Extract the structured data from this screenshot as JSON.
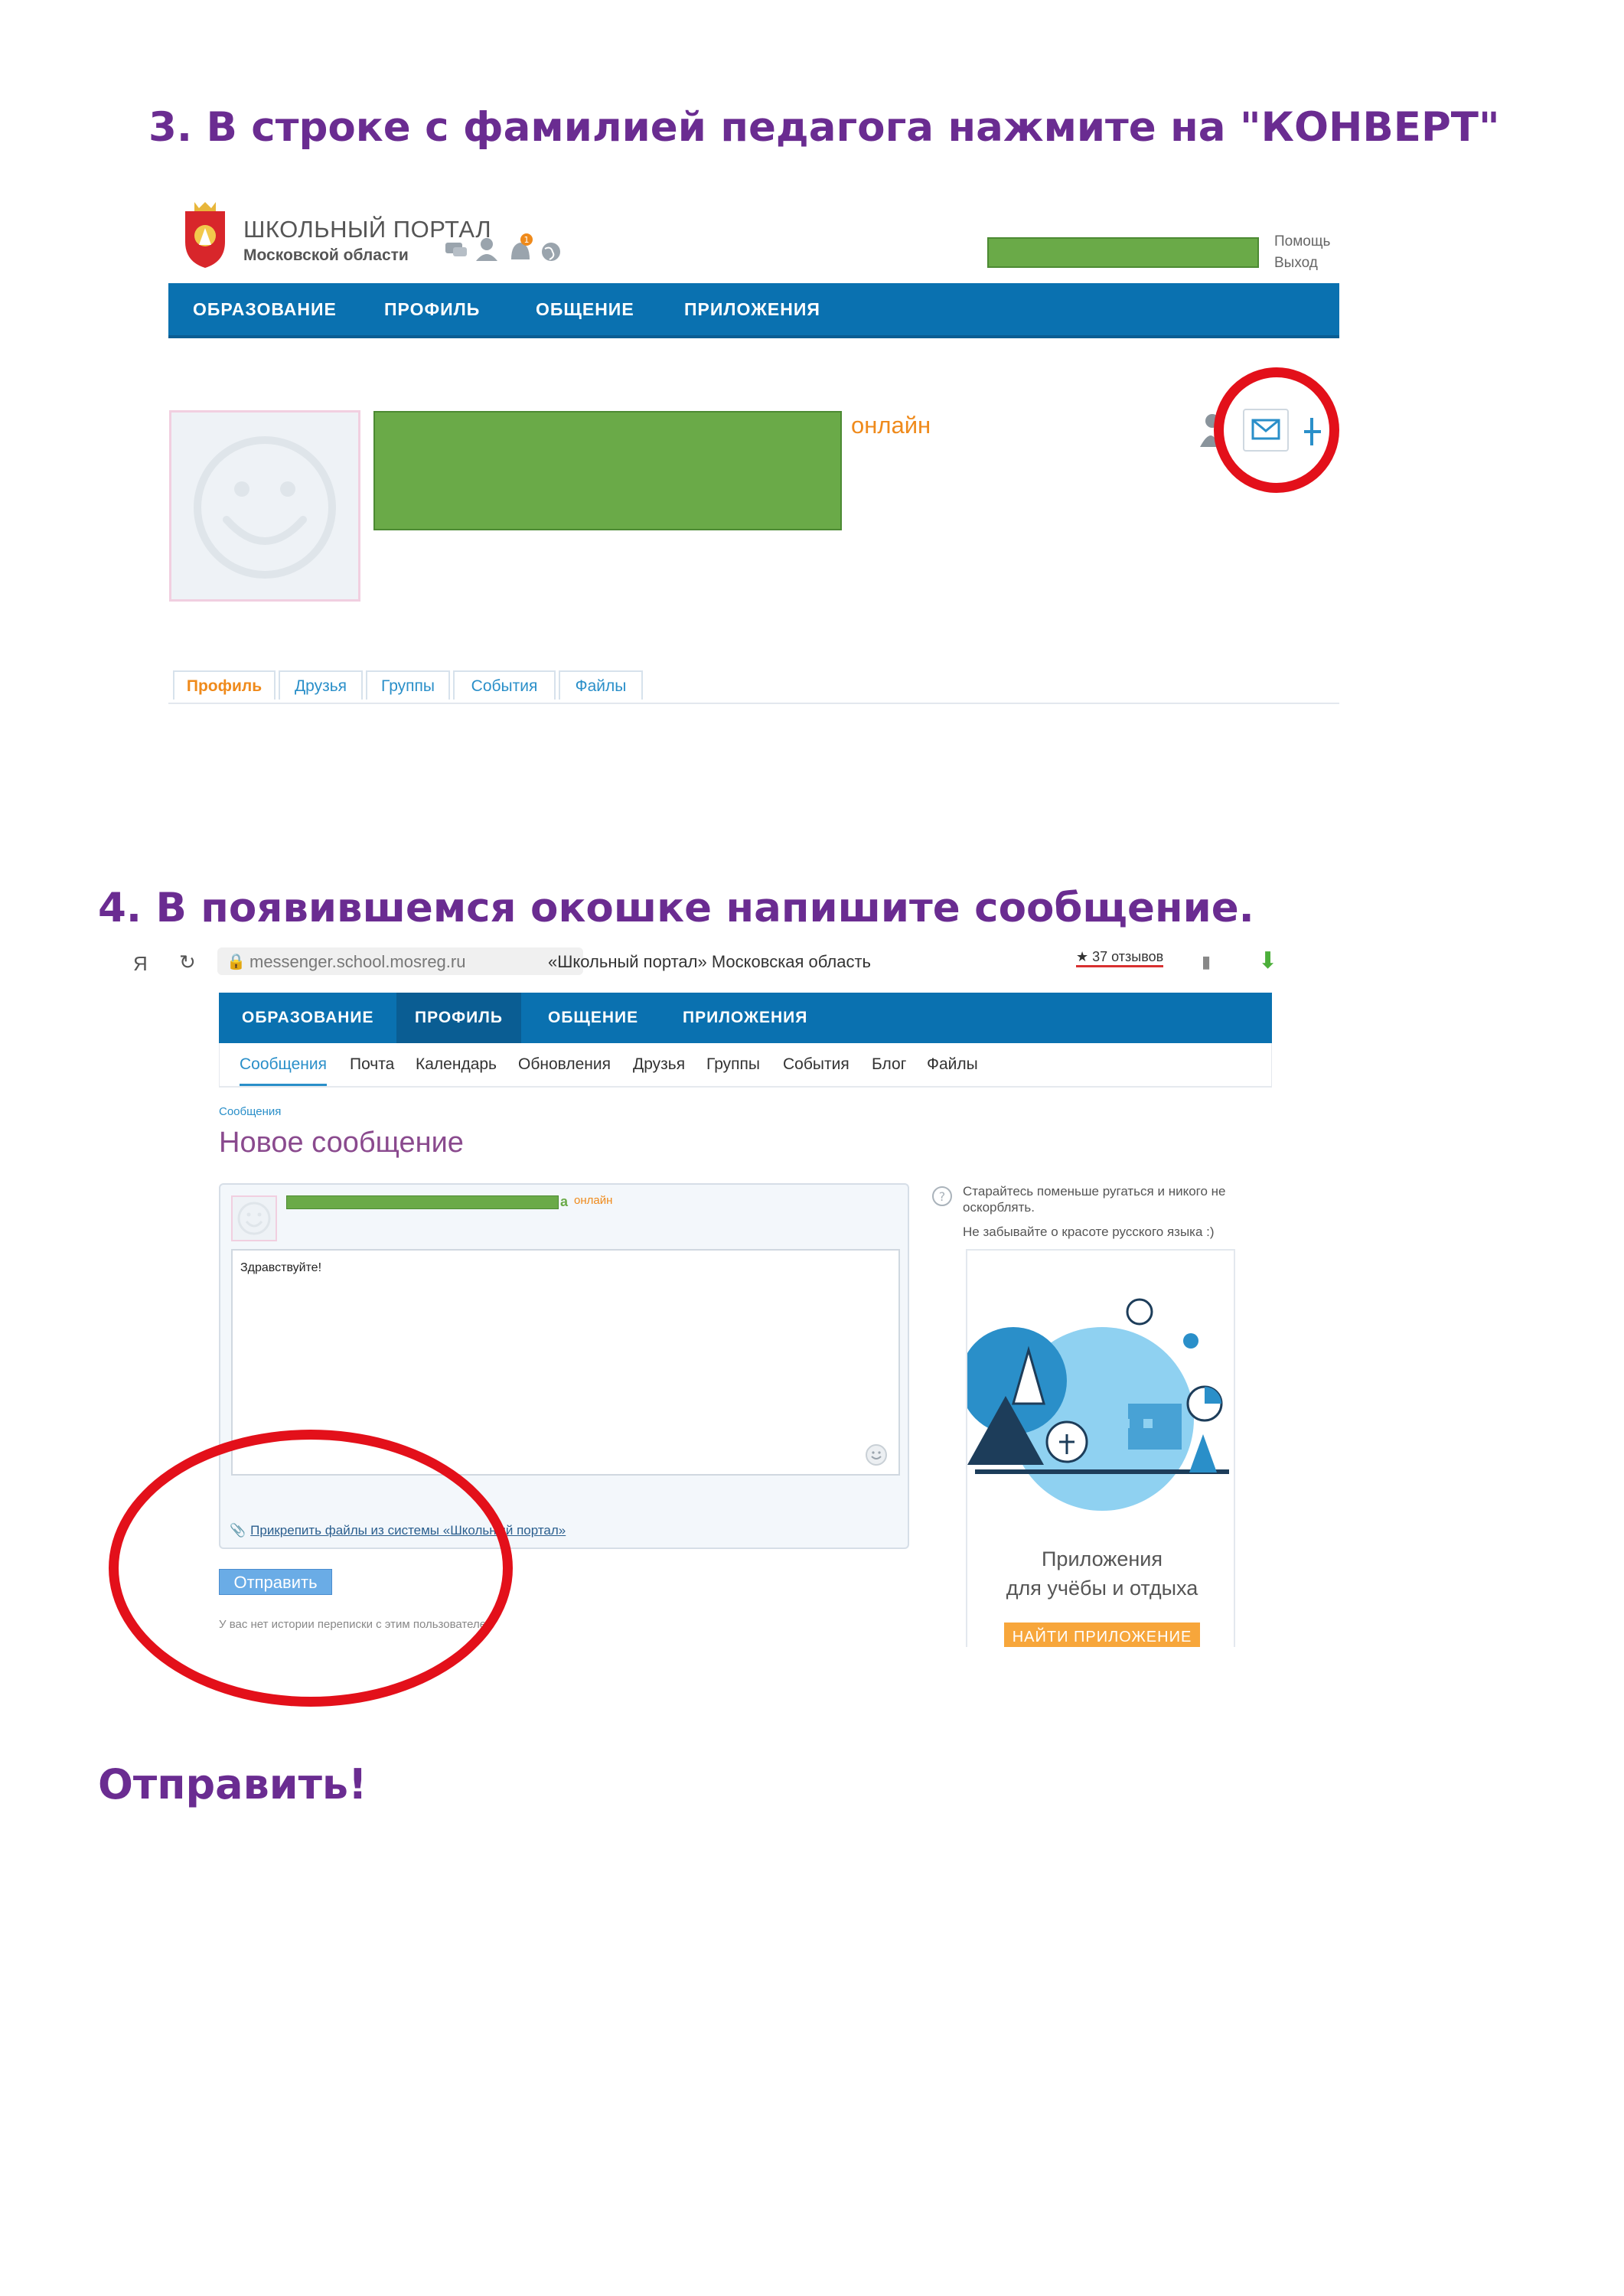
{
  "step3": {
    "heading": "3. В строке с фамилией педагога нажмите на \"КОНВЕРТ\"",
    "logo": {
      "title": "ШКОЛЬНЫЙ ПОРТАЛ",
      "subtitle": "Московской области"
    },
    "notification_count": "1",
    "top_links": {
      "help": "Помощь",
      "logout": "Выход"
    },
    "nav": [
      "ОБРАЗОВАНИЕ",
      "ПРОФИЛЬ",
      "ОБЩЕНИЕ",
      "ПРИЛОЖЕНИЯ"
    ],
    "status": "онлайн",
    "tabs": [
      "Профиль",
      "Друзья",
      "Группы",
      "События",
      "Файлы"
    ]
  },
  "step4": {
    "heading": "4. В появившемся окошке напишите сообщение.",
    "browser": {
      "yandex": "Я",
      "url": "messenger.school.mosreg.ru",
      "page_title": "«Школьный портал» Московская область",
      "reviews": "★ 37 отзывов"
    },
    "nav": [
      "ОБРАЗОВАНИЕ",
      "ПРОФИЛЬ",
      "ОБЩЕНИЕ",
      "ПРИЛОЖЕНИЯ"
    ],
    "subnav": [
      "Сообщения",
      "Почта",
      "Календарь",
      "Обновления",
      "Друзья",
      "Группы",
      "События",
      "Блог",
      "Файлы"
    ],
    "breadcrumb": "Сообщения",
    "title": "Новое сообщение",
    "recipient_tail": "а",
    "recipient_status": "онлайн",
    "message_text": "Здравствуйте!",
    "attach_link": "Прикрепить файлы из системы «Школьный портал»",
    "send_button": "Отправить",
    "history_note": "У вас нет истории переписки с этим пользователем",
    "tip_line1": "Старайтесь поменьше ругаться и никого не оскорблять.",
    "tip_line2": "Не забывайте о красоте русского языка :)",
    "ad": {
      "title_line1": "Приложения",
      "title_line2": "для учёбы и отдыха",
      "button": "НАЙТИ ПРИЛОЖЕНИЕ"
    }
  },
  "final_text": "Отправить!",
  "colors": {
    "heading": "#6a2c91",
    "nav": "#0a71b0",
    "online": "#ef8a1b",
    "redacted": "#6aaa48",
    "highlight": "#e3101a"
  }
}
